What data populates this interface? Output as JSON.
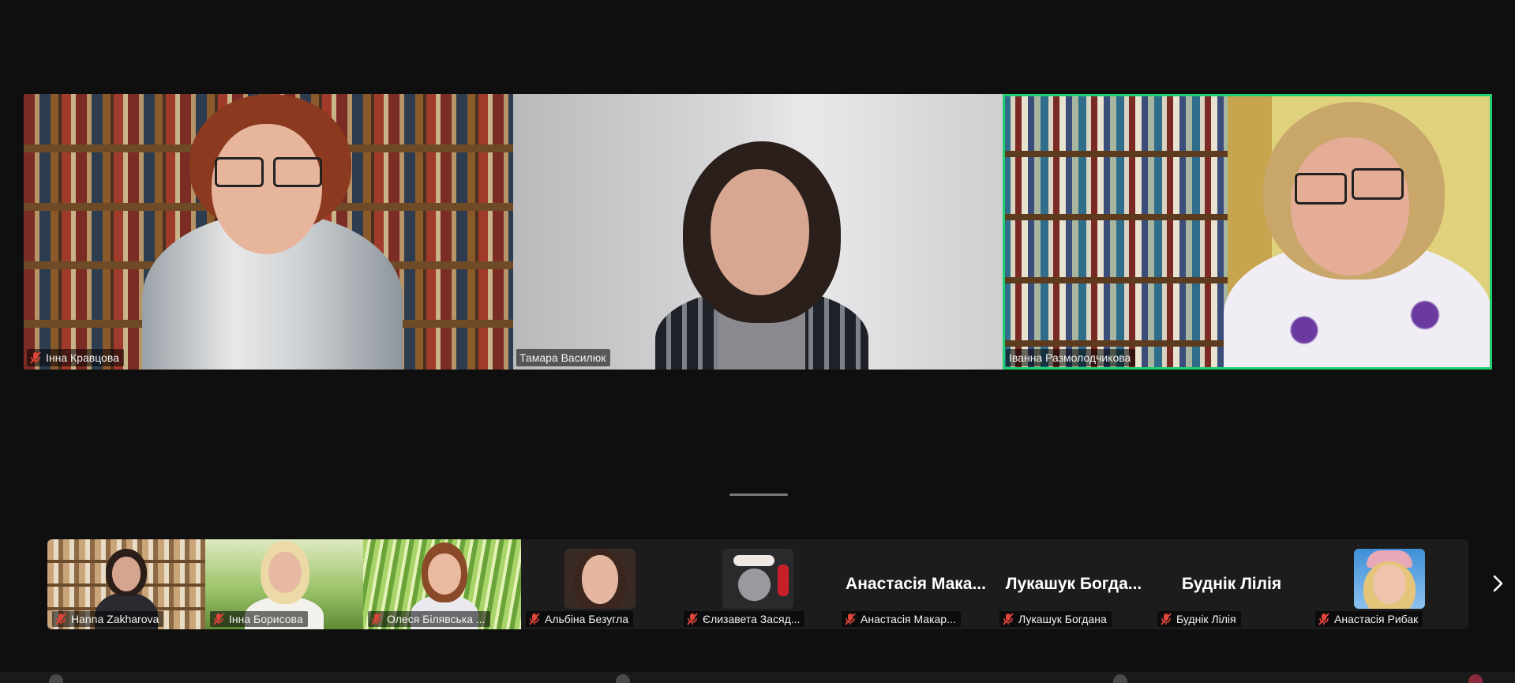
{
  "main_tiles": [
    {
      "name": "Інна Кравцова",
      "muted": true,
      "active": false
    },
    {
      "name": "Тамара Василюк",
      "muted": false,
      "active": false
    },
    {
      "name": "Іванна Размолодчикова",
      "muted": false,
      "active": true
    }
  ],
  "gallery": [
    {
      "name": "Hanna Zakharova",
      "muted": true,
      "kind": "video"
    },
    {
      "name": "Інна Борисова",
      "muted": true,
      "kind": "video"
    },
    {
      "name": "Олеся Білявська ...",
      "muted": true,
      "kind": "video"
    },
    {
      "name": "Альбіна Безугла",
      "muted": true,
      "kind": "photo"
    },
    {
      "name": "Єлизавета Засяд...",
      "muted": true,
      "kind": "photo"
    },
    {
      "name": "Анастасія Макар...",
      "big_name": "Анастасія Мака...",
      "muted": true,
      "kind": "name"
    },
    {
      "name": "Лукашук Богдана",
      "big_name": "Лукашук Богда...",
      "muted": true,
      "kind": "name"
    },
    {
      "name": "Буднік Лілія",
      "big_name": "Буднік Лілія",
      "muted": true,
      "kind": "name"
    },
    {
      "name": "Анастасія Рибак",
      "muted": true,
      "kind": "photo"
    }
  ],
  "colors": {
    "background": "#0f0f0f",
    "active_speaker_border": "#1fd06f",
    "mute_icon": "#e0453a",
    "gallery_bg": "#1c1c1c"
  },
  "icons": {
    "mute": "microphone-muted-icon",
    "next_page": "chevron-right-icon"
  }
}
